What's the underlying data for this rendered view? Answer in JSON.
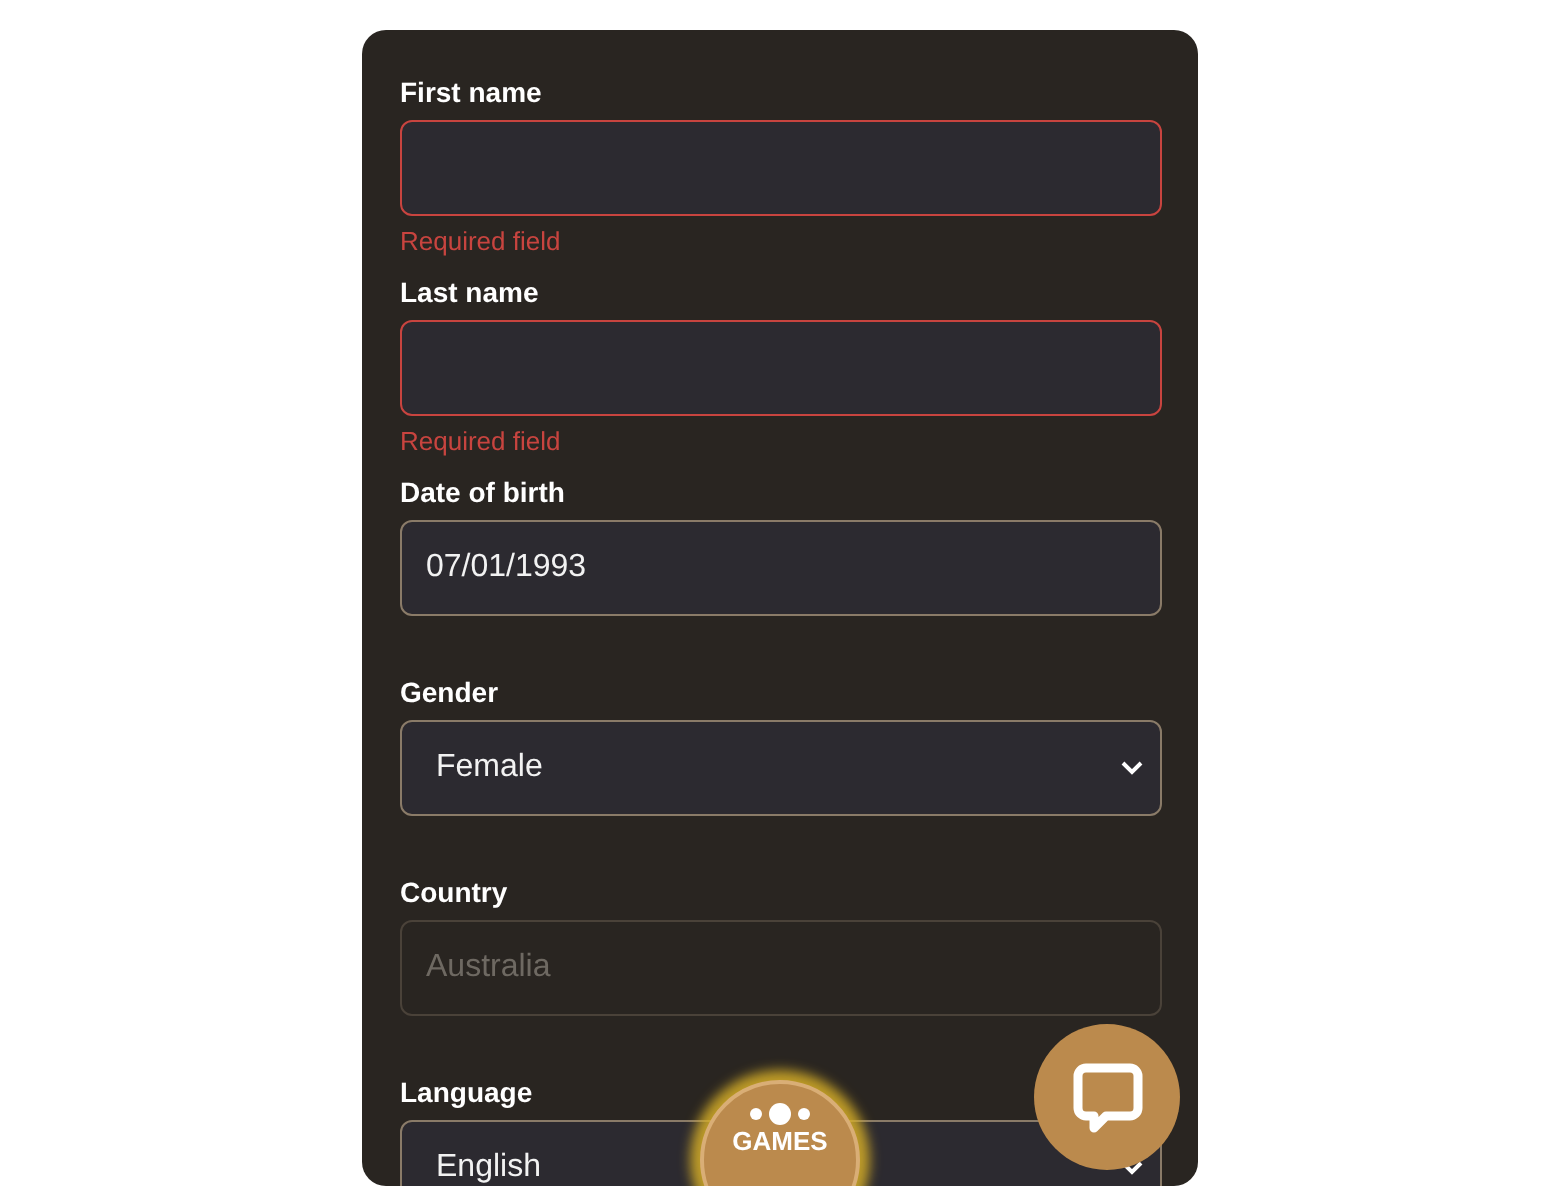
{
  "fields": [
    {
      "kind": "text",
      "label": "First name",
      "error": "Required field",
      "disabled": false
    },
    {
      "kind": "text",
      "label": "Last name",
      "error": "Required field",
      "disabled": false
    },
    {
      "kind": "date",
      "label": "Date of birth",
      "value": "07/01/1993",
      "disabled": false
    },
    {
      "kind": "select",
      "label": "Gender",
      "value": "Female",
      "disabled": false
    },
    {
      "kind": "text",
      "label": "Country",
      "value": "Australia",
      "disabled": true
    },
    {
      "kind": "select",
      "label": "Language",
      "value": "English",
      "disabled": false
    }
  ],
  "games_button": {
    "label": "GAMES"
  }
}
